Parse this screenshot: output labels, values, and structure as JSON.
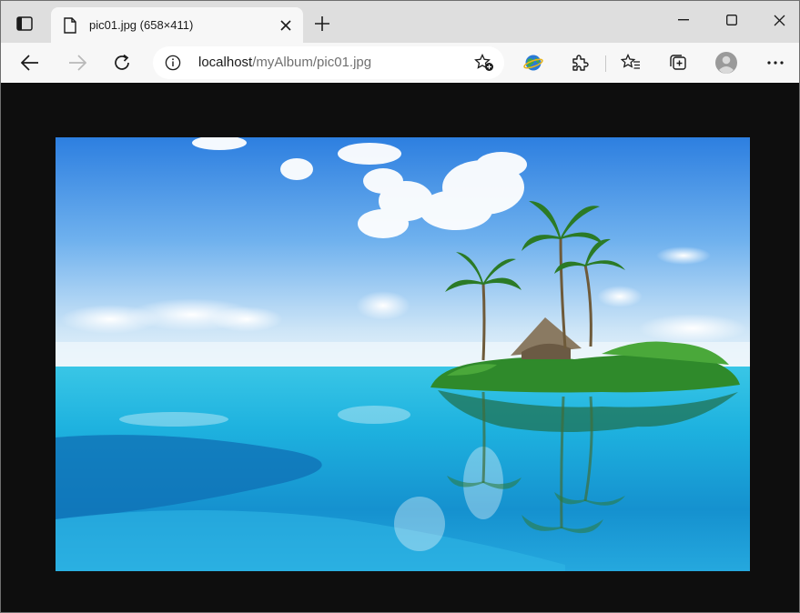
{
  "tab": {
    "title": "pic01.jpg (658×411)"
  },
  "address": {
    "host": "localhost",
    "path": "/myAlbum/pic01.jpg"
  },
  "icons": {
    "tab_actions": "tab-actions-icon",
    "favicon": "page-icon",
    "close": "close-icon",
    "new_tab": "plus-icon",
    "minimize": "minimize-icon",
    "maximize": "maximize-icon",
    "close_window": "close-window-icon",
    "back": "back-arrow-icon",
    "forward": "forward-arrow-icon",
    "refresh": "refresh-icon",
    "info": "info-icon",
    "add_favorite": "star-plus-icon",
    "extension_globe": "globe-extension-icon",
    "extensions": "puzzle-icon",
    "favorites": "favorites-icon",
    "collections": "collections-icon",
    "profile": "profile-icon",
    "menu": "more-icon"
  },
  "colors": {
    "tabstrip": "#dedede",
    "toolbar": "#f7f7f7",
    "page_background": "#0e0e0e"
  },
  "image": {
    "description_icon": "tropical-island-photo"
  }
}
